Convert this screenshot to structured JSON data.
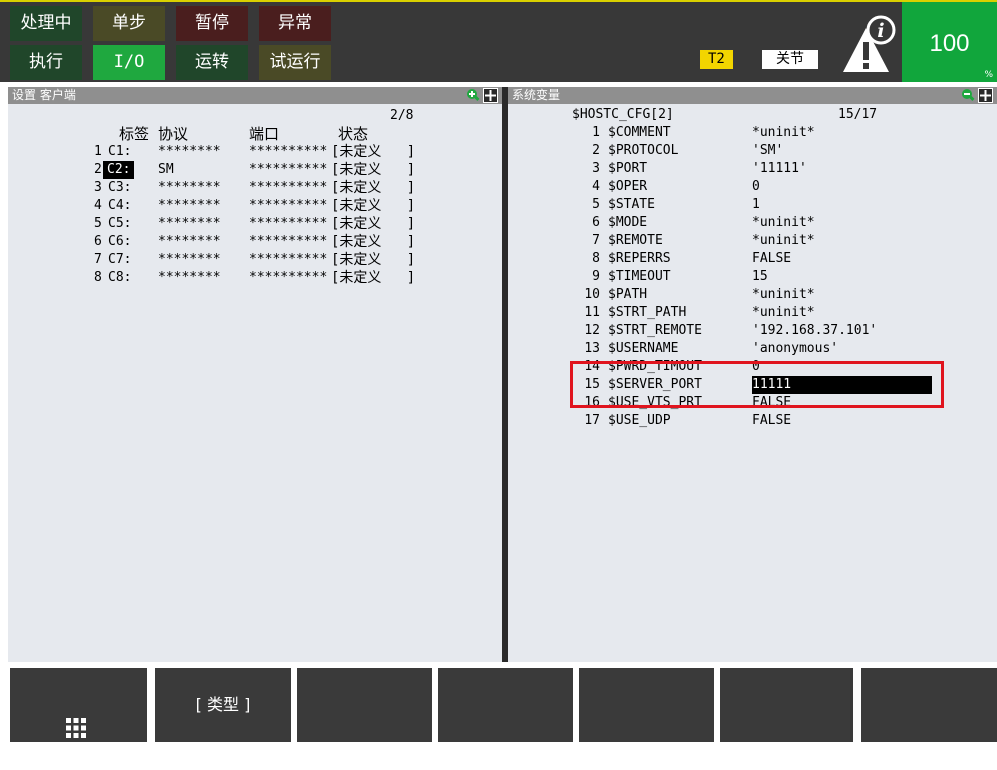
{
  "status": {
    "row1": [
      {
        "label": "处理中",
        "bg": "#20462a"
      },
      {
        "label": "单步",
        "bg": "#4a4a26"
      },
      {
        "label": "暂停",
        "bg": "#4a1e1e"
      },
      {
        "label": "异常",
        "bg": "#4a1e1e"
      }
    ],
    "row2": [
      {
        "label": "执行",
        "bg": "#20462a"
      },
      {
        "label": "I/O",
        "bg": "#1fa83f"
      },
      {
        "label": "运转",
        "bg": "#20462a"
      },
      {
        "label": "试运行",
        "bg": "#4a4a26"
      }
    ],
    "mode": "T2",
    "joint_label": "关节",
    "override": "100",
    "override_unit": "%"
  },
  "left_pane": {
    "title": "设置 客户端",
    "page": "2/8",
    "headers": {
      "tag": "标签",
      "protocol": "协议",
      "port": "端口",
      "state": "状态"
    },
    "rows": [
      {
        "num": "1",
        "tag": "C1:",
        "protocol": "********",
        "port": "**********",
        "state": "[未定义   ]"
      },
      {
        "num": "2",
        "tag": "C2:",
        "protocol": "SM",
        "port": "**********",
        "state": "[未定义   ]"
      },
      {
        "num": "3",
        "tag": "C3:",
        "protocol": "********",
        "port": "**********",
        "state": "[未定义   ]"
      },
      {
        "num": "4",
        "tag": "C4:",
        "protocol": "********",
        "port": "**********",
        "state": "[未定义   ]"
      },
      {
        "num": "5",
        "tag": "C5:",
        "protocol": "********",
        "port": "**********",
        "state": "[未定义   ]"
      },
      {
        "num": "6",
        "tag": "C6:",
        "protocol": "********",
        "port": "**********",
        "state": "[未定义   ]"
      },
      {
        "num": "7",
        "tag": "C7:",
        "protocol": "********",
        "port": "**********",
        "state": "[未定义   ]"
      },
      {
        "num": "8",
        "tag": "C8:",
        "protocol": "********",
        "port": "**********",
        "state": "[未定义   ]"
      }
    ]
  },
  "right_pane": {
    "title": "系统变量",
    "var_name": "$HOSTC_CFG[2]",
    "page": "15/17",
    "rows": [
      {
        "num": "1",
        "name": "$COMMENT",
        "value": "*uninit*"
      },
      {
        "num": "2",
        "name": "$PROTOCOL",
        "value": "'SM'"
      },
      {
        "num": "3",
        "name": "$PORT",
        "value": "'11111'"
      },
      {
        "num": "4",
        "name": "$OPER",
        "value": "0"
      },
      {
        "num": "5",
        "name": "$STATE",
        "value": "1"
      },
      {
        "num": "6",
        "name": "$MODE",
        "value": "*uninit*"
      },
      {
        "num": "7",
        "name": "$REMOTE",
        "value": "*uninit*"
      },
      {
        "num": "8",
        "name": "$REPERRS",
        "value": "FALSE"
      },
      {
        "num": "9",
        "name": "$TIMEOUT",
        "value": "15"
      },
      {
        "num": "10",
        "name": "$PATH",
        "value": "*uninit*"
      },
      {
        "num": "11",
        "name": "$STRT_PATH",
        "value": "*uninit*"
      },
      {
        "num": "12",
        "name": "$STRT_REMOTE",
        "value": "'192.168.37.101'"
      },
      {
        "num": "13",
        "name": "$USERNAME",
        "value": "'anonymous'"
      },
      {
        "num": "14",
        "name": "$PWRD_TIMOUT",
        "value": "0"
      },
      {
        "num": "15",
        "name": "$SERVER_PORT",
        "value": "11111"
      },
      {
        "num": "16",
        "name": "$USE_VTS_PRT",
        "value": "FALSE"
      },
      {
        "num": "17",
        "name": "$USE_UDP",
        "value": "FALSE"
      }
    ],
    "selected_row": "15",
    "highlight_color": "#e0141e"
  },
  "function_keys": {
    "f1": "",
    "f2": "[ 类型 ]",
    "f3": "",
    "f4": "",
    "f5": "",
    "f6": "",
    "f7": ""
  }
}
